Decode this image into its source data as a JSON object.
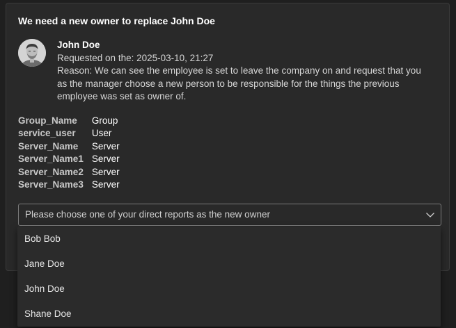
{
  "card": {
    "title": "We need a new owner to replace John Doe"
  },
  "requester": {
    "name": "John Doe",
    "requested_on": "Requested on the: 2025-03-10, 21:27",
    "reason": "Reason: We can see the employee is set to leave the company on and request that you as the manager choose a new person to be responsible for the things the previous employee was set as owner of."
  },
  "details": [
    {
      "key": "Group_Name",
      "value": "Group"
    },
    {
      "key": "service_user",
      "value": "User"
    },
    {
      "key": "Server_Name",
      "value": "Server"
    },
    {
      "key": "Server_Name1",
      "value": "Server"
    },
    {
      "key": "Server_Name2",
      "value": "Server"
    },
    {
      "key": "Server_Name3",
      "value": "Server"
    }
  ],
  "owner_select": {
    "placeholder": "Please choose one of your direct reports as the new owner",
    "options": [
      "Bob Bob",
      "Jane Doe",
      "John Doe",
      "Shane Doe"
    ]
  },
  "icons": {
    "avatar": "user-avatar-photo",
    "dropdown": "chevron-down-icon"
  },
  "colors": {
    "background": "#1f1f1f",
    "card": "#292929",
    "dropdown_menu": "#2b2b2b",
    "text": "#ffffff"
  }
}
